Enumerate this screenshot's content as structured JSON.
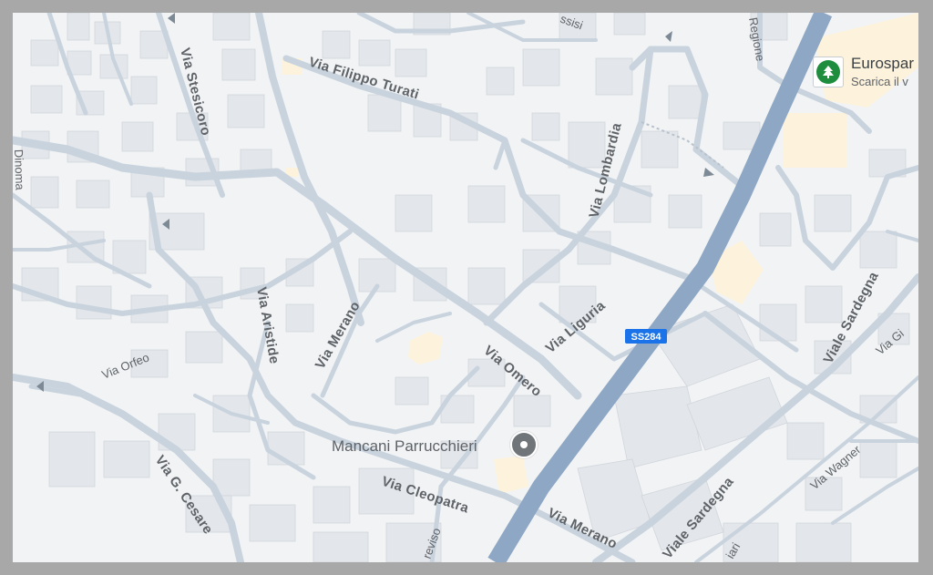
{
  "streets": {
    "via_filippo_turati": "Via Filippo Turati",
    "via_stesicoro": "Via Stesicoro",
    "via_lombardia": "Via Lombardia",
    "via_regione": "Regione",
    "via_orfeo": "Via Orfeo",
    "via_aristide": "Via Aristide",
    "via_merano_north": "Via Merano",
    "via_omero": "Via Omero",
    "via_liguria": "Via Liguria",
    "viale_sardegna_north": "Viale Sardegna",
    "viale_sardegna_south": "Viale Sardegna",
    "via_wagner": "Via Wagner",
    "via_gi": "Via Gi",
    "via_g_cesare": "Via G. Cesare",
    "via_cleopatra": "Via Cleopatra",
    "via_merano_south": "Via Merano",
    "treviso": "reviso",
    "via_fragment_top": "ssisi",
    "via_fragment_left": "Dinoma",
    "via_fragment_bottom": "iari"
  },
  "road_shield": "SS284",
  "poi": {
    "name": "Mancani Parrucchieri",
    "icon": "pin-icon"
  },
  "shop": {
    "name": "Eurospar",
    "subtitle": "Scarica il v",
    "icon": "eurospar-logo-icon"
  },
  "colors": {
    "background": "#f1f3f4",
    "building": "#e3e6ea",
    "road": "#c8d3de",
    "highway": "#8ea7c4",
    "highlight": "#fdf3dc",
    "shield": "#1a73e8"
  }
}
